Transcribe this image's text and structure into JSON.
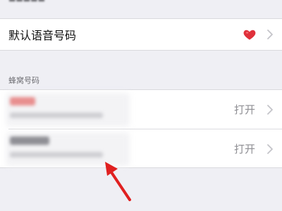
{
  "default_voice": {
    "label": "默认语音号码",
    "icon": "heart-icon",
    "chevron": "chevron-right-icon"
  },
  "cellular": {
    "header": "蜂窝号码",
    "rows": [
      {
        "status": "打开",
        "chevron": "chevron-right-icon"
      },
      {
        "status": "打开",
        "chevron": "chevron-right-icon"
      }
    ]
  },
  "colors": {
    "background": "#efeff4",
    "cell": "#ffffff",
    "heart": "#e0313b",
    "arrow": "#e02020",
    "secondary_text": "#8e8e93"
  }
}
